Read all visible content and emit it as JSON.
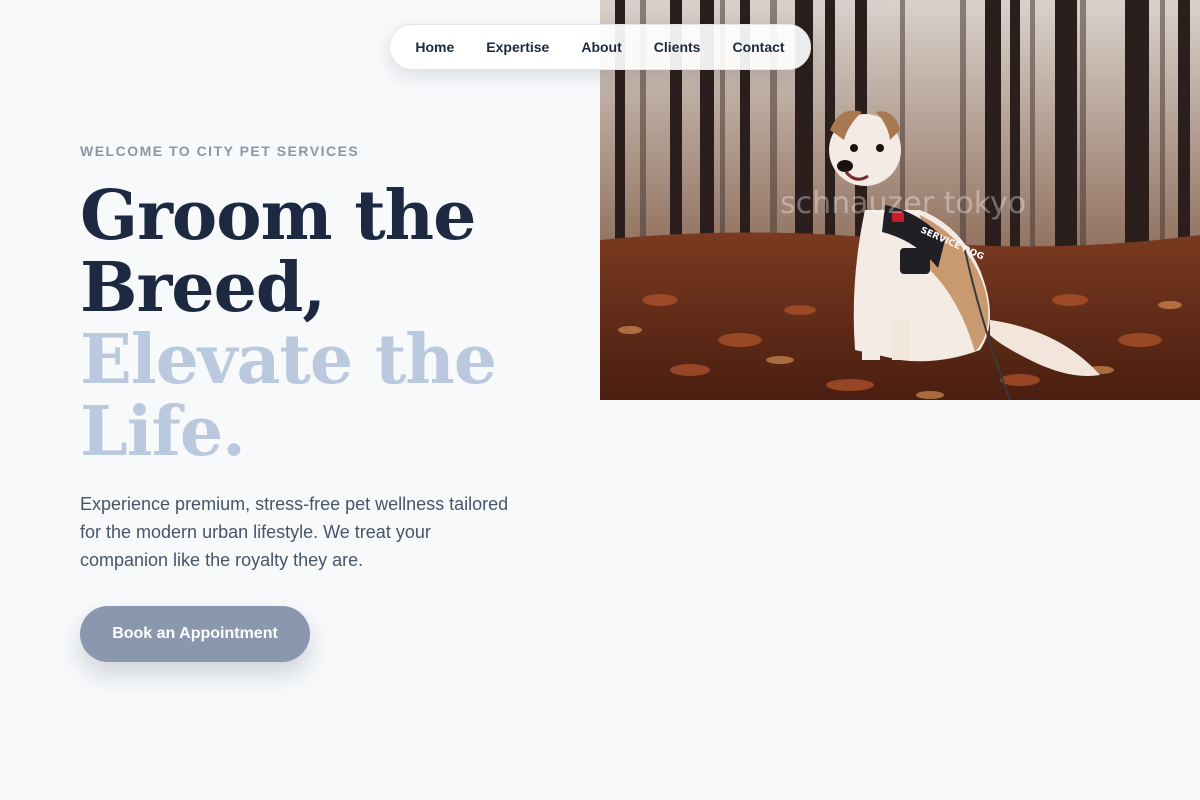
{
  "nav": {
    "items": [
      {
        "label": "Home"
      },
      {
        "label": "Expertise"
      },
      {
        "label": "About"
      },
      {
        "label": "Clients"
      },
      {
        "label": "Contact"
      }
    ]
  },
  "hero": {
    "eyebrow": "WELCOME TO CITY PET SERVICES",
    "headline_line1": "Groom the",
    "headline_line2": "Breed,",
    "headline_line3": "Elevate the",
    "headline_line4": "Life.",
    "lead": "Experience premium, stress-free pet wellness tailored for the modern urban lifestyle. We treat your companion like the royalty they are.",
    "cta_label": "Book an Appointment",
    "photo": {
      "icon": "dog-photo",
      "harness_text": "SERVICE DOG",
      "watermark": "schnauzer tokyo"
    }
  },
  "colors": {
    "background": "#f7f9fb",
    "headline_dark": "#1c2940",
    "headline_light": "#bac9de",
    "cta": "#8a97ae",
    "eyebrow": "#8a97a8"
  }
}
